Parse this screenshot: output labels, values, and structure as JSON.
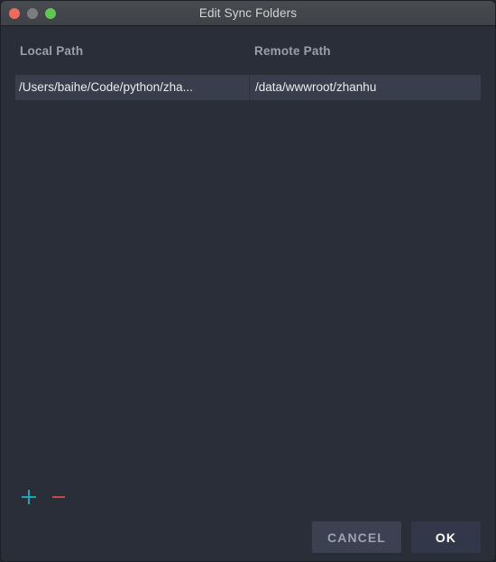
{
  "window": {
    "title": "Edit Sync Folders",
    "traffic_lights": [
      {
        "name": "close",
        "color": "#ec6a5f"
      },
      {
        "name": "minimize",
        "color": "#7d7d7d"
      },
      {
        "name": "maximize",
        "color": "#62c554"
      }
    ]
  },
  "table": {
    "columns": [
      {
        "key": "local",
        "header": "Local Path"
      },
      {
        "key": "remote",
        "header": "Remote Path"
      }
    ],
    "rows": [
      {
        "local": "/Users/baihe/Code/python/zha...",
        "remote": "/data/wwwroot/zhanhu"
      }
    ]
  },
  "row_controls": {
    "add": {
      "icon": "plus-icon",
      "color": "#1aa7b8"
    },
    "remove": {
      "icon": "minus-icon",
      "color": "#c44b46"
    }
  },
  "footer": {
    "cancel_label": "CANCEL",
    "ok_label": "OK"
  }
}
